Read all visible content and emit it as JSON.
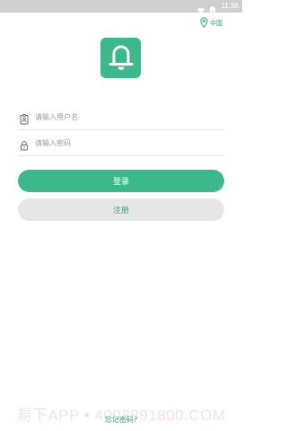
{
  "status_bar": {
    "time": "11:38",
    "icons": [
      "wifi-icon",
      "battery-charging-icon"
    ]
  },
  "region": {
    "label": "中国",
    "icon": "location-pin-icon"
  },
  "app": {
    "logo_icon": "bell-icon"
  },
  "form": {
    "username": {
      "placeholder": "请输入用户名",
      "icon": "user-card-icon"
    },
    "password": {
      "placeholder": "请输入密码",
      "icon": "lock-icon"
    },
    "login_label": "登录",
    "register_label": "注册",
    "forgot_label": "忘记密码?"
  },
  "watermark": {
    "text": "易下APP • 4008891800.COM"
  },
  "colors": {
    "accent": "#3db88a",
    "accent_text": "#3b9c80",
    "status_bar": "#cfcfcf",
    "secondary_button": "#e6e6e6",
    "divider": "#e5e5e5"
  }
}
